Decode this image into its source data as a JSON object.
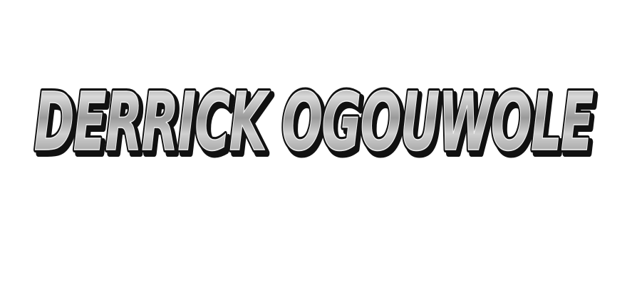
{
  "logo": {
    "text": "DERRICK OGOUWOLE",
    "fill_light": "#e6e6e6",
    "fill_mid": "#b4b4b4",
    "fill_dark": "#8c8c8c",
    "outline": "#111111",
    "shadow": "#2a2a2a"
  }
}
